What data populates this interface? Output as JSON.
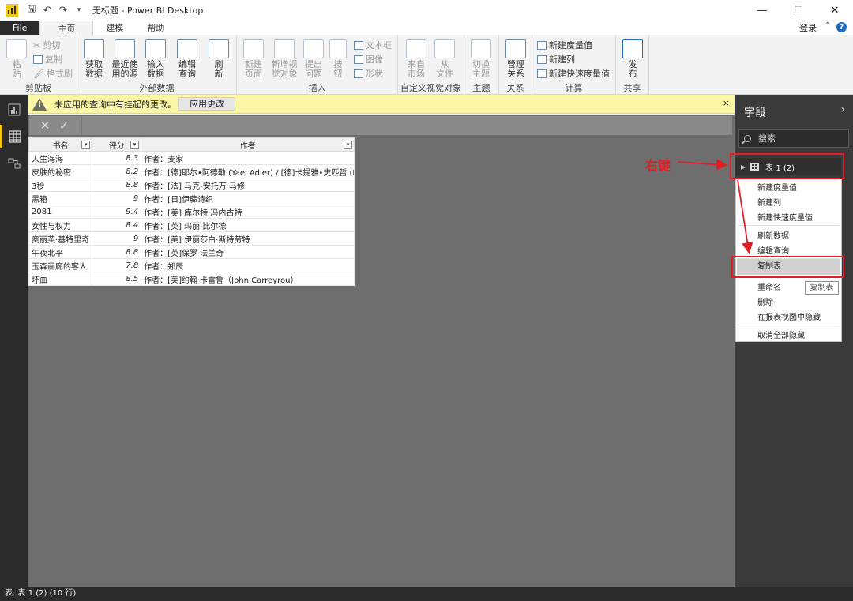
{
  "window": {
    "title": "无标题 - Power BI Desktop"
  },
  "tabs": {
    "file": "File",
    "home": "主页",
    "modeling": "建模",
    "help": "帮助",
    "login": "登录"
  },
  "ribbon": {
    "clipboard": {
      "paste": "粘\n贴",
      "cut": "剪切",
      "copy": "复制",
      "format_painter": "格式刷",
      "label": "剪贴板"
    },
    "external": {
      "get_data": "获取\n数据",
      "recent": "最近使\n用的源",
      "enter": "输入\n数据",
      "edit": "编辑\n查询",
      "refresh": "刷\n新",
      "label": "外部数据"
    },
    "insert": {
      "new_page": "新建\n页面",
      "new_visual": "新增视\n觉对象",
      "ask": "提出\n问题",
      "buttons": "按\n钮",
      "textbox": "文本框",
      "image": "图像",
      "shapes": "形状",
      "label": "插入"
    },
    "custom_visuals": {
      "from_market": "来自\n市场",
      "from_file": "从\n文件",
      "label": "自定义视觉对象"
    },
    "theme": {
      "switch": "切换\n主题",
      "label": "主题"
    },
    "relationships": {
      "manage": "管理\n关系",
      "label": "关系"
    },
    "calculations": {
      "new_measure": "新建度量值",
      "new_column": "新建列",
      "new_quick_measure": "新建快速度量值",
      "label": "计算"
    },
    "share": {
      "publish": "发\n布",
      "label": "共享"
    }
  },
  "warning": {
    "text": "未应用的查询中有挂起的更改。",
    "apply": "应用更改",
    "close": "×"
  },
  "formula": {
    "cancel": "✕",
    "commit": "✓"
  },
  "table": {
    "headers": [
      "书名",
      "评分",
      "作者"
    ],
    "rows": [
      [
        "人生海海",
        "8.3",
        "作者：麦家"
      ],
      [
        "皮肤的秘密",
        "8.2",
        "作者：[德]耶尔•阿德勒 (Yael Adler) / [德]卡提雅•史匹哲 (Katja"
      ],
      [
        "3秒",
        "8.8",
        "作者：[法] 马克-安托万·马修"
      ],
      [
        "黑箱",
        "9",
        "作者：[日]伊藤诗织"
      ],
      [
        "2081",
        "9.4",
        "作者：[美] 库尔特·冯内古特"
      ],
      [
        "女性与权力",
        "8.4",
        "作者：[英] 玛丽·比尔德"
      ],
      [
        "奥丽芙·基特里奇",
        "9",
        "作者：[美] 伊丽莎白·斯特劳特"
      ],
      [
        "午夜北平",
        "8.8",
        "作者：[英]保罗 法兰奇"
      ],
      [
        "玉森画廊的客人",
        "7.8",
        "作者：郑辰"
      ],
      [
        "坏血",
        "8.5",
        "作者：[美]约翰·卡雷鲁（John Carreyrou）"
      ]
    ]
  },
  "fields_panel": {
    "title": "字段",
    "search_placeholder": "搜索",
    "table_name": "表 1 (2)"
  },
  "context_menu": {
    "items": [
      "新建度量值",
      "新建列",
      "新建快速度量值",
      "刷新数据",
      "编辑查询",
      "复制表",
      "重命名",
      "删除",
      "在报表视图中隐藏",
      "取消全部隐藏"
    ],
    "tooltip": "复制表"
  },
  "annotation": {
    "right_click": "右键"
  },
  "status": {
    "text": "表: 表 1 (2) (10 行)"
  }
}
